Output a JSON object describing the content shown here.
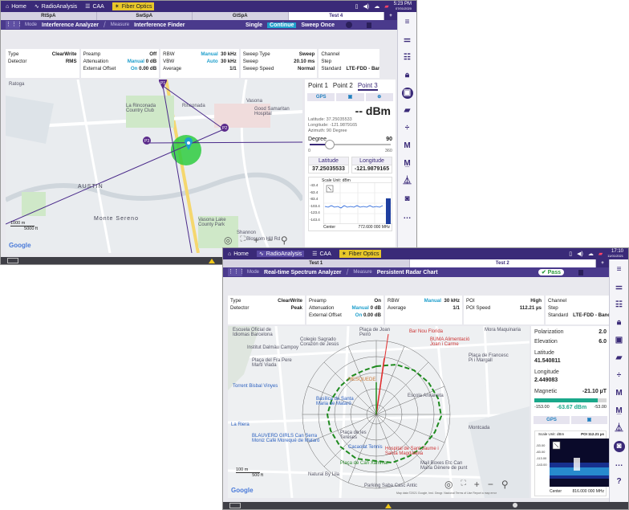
{
  "app": {
    "home": "Home",
    "radio_analysis": "RadioAnalysis",
    "caa": "CAA",
    "fiber_optics": "Fiber Optics"
  },
  "win1": {
    "time": "5:23 PM",
    "date": "07/01/2020",
    "tabs": [
      "RtSpA",
      "SwSpA",
      "GtSpA",
      "Test 4"
    ],
    "mode_label": "Mode",
    "mode_value": "Interference Analyzer",
    "measure_label": "Measure",
    "measure_value": "Interference Finder",
    "single": "Single",
    "continue": "Continue",
    "sweep_once": "Sweep Once",
    "params": {
      "type_label": "Type",
      "type_value": "ClearWrite",
      "detector_label": "Detector",
      "detector_value": "RMS",
      "preamp_label": "Preamp",
      "preamp_value": "Off",
      "atten_label": "Attenuation",
      "atten_mode": "Manual",
      "atten_value": "0 dB",
      "extoff_label": "External Offset",
      "extoff_mode": "On",
      "extoff_value": "0.00 dB",
      "rbw_label": "RBW",
      "rbw_mode": "Manual",
      "rbw_value": "30 kHz",
      "vbw_label": "VBW",
      "vbw_mode": "Auto",
      "vbw_value": "30 kHz",
      "avg_label": "Average",
      "avg_value": "1/1",
      "sweeptype_label": "Sweep Type",
      "sweeptype_value": "Sweep",
      "sweep_label": "Sweep",
      "sweep_value": "20.10 ms",
      "sweepspeed_label": "Sweep Speed",
      "sweepspeed_value": "Normal",
      "channel_label": "Channel",
      "step_label": "Step",
      "standard_label": "Standard",
      "standard_value": "LTE-FDD - Band"
    },
    "map_labels": [
      "Ratoga",
      "La Rinconada Country Club",
      "Rinconada",
      "Vasona",
      "Good Samaritan Hospital",
      "AUSTIN",
      "Monte Sereno",
      "Vasona Lake County Park",
      "Shannon",
      "Blossom Hill Rd"
    ],
    "scale_1": "1000 m",
    "scale_2": "5000 ft",
    "google": "Google",
    "markers": [
      "P1",
      "P2",
      "P3"
    ],
    "panel": {
      "tabs": [
        "Point 1",
        "Point 2",
        "Point 3"
      ],
      "gps": "GPS",
      "dbm": "-- dBm",
      "latitude_line": "Latitude: 37.25035533",
      "longitude_line": "Longitude: -121.9879165",
      "azimuth_line": "Azimuth: 90 Degree",
      "degree_label": "Degree",
      "degree_value": "90",
      "deg_min": "0",
      "deg_max": "360",
      "lat_h": "Latitude",
      "lat_v": "37.25035533",
      "lon_h": "Longitude",
      "lon_v": "-121.9879165",
      "scale_unit": "Scale Unit: dBm",
      "yticks": [
        "-43.4",
        "-63.4",
        "-83.4",
        "-103.4",
        "-123.4",
        "-143.4"
      ],
      "center_label": "Center",
      "center_value": "772.600 000 MHz"
    }
  },
  "win2": {
    "time": "17:10",
    "date": "11/01/2021",
    "tabs": [
      "Test 1",
      "Test 2"
    ],
    "mode_label": "Mode",
    "mode_value": "Real-time Spectrum Analyzer",
    "measure_label": "Measure",
    "measure_value": "Persistent Radar Chart",
    "pass": "Pass",
    "params": {
      "type_label": "Type",
      "type_value": "ClearWrite",
      "detector_label": "Detector",
      "detector_value": "Peak",
      "preamp_label": "Preamp",
      "preamp_value": "On",
      "atten_label": "Attenuation",
      "atten_mode": "Manual",
      "atten_value": "0 dB",
      "extoff_label": "External Offset",
      "extoff_mode": "On",
      "extoff_value": "0.00 dB",
      "rbw_label": "RBW",
      "rbw_mode": "Manual",
      "rbw_value": "30 kHz",
      "avg_label": "Average",
      "avg_value": "1/1",
      "poi_label": "POI",
      "poi_value": "High",
      "poispeed_label": "POI Speed",
      "poispeed_value": "112.21 µs",
      "channel_label": "Channel",
      "step_label": "Step",
      "standard_label": "Standard",
      "standard_value": "LTE-FDD - Band"
    },
    "map_labels": [
      "Escuela Oficial de Idiomas Barcelona",
      "Institut Dalmàu Campoy",
      "Colegio Sagrado Corazón de Jesús",
      "Plaça de Joan Peiró",
      "Bar Nou Florida",
      "BUMA Alimentació Joan i Carme",
      "Plaça del Fra Pere Martí Viada",
      "MESQUEDE",
      "Plaça de Francesc Pi i Margall",
      "Torrent Bisbal Vinyes",
      "Basílica de Santa Maria de Mataró",
      "Escola Anxaneta",
      "La Riera",
      "BLAUVERD GIRLS Can Serra Moniz Café Morequé de Mataró",
      "Plaça de les Tereses",
      "Cacaolat Tennis",
      "Hospital de Sant Jaume i Santa Magdalena",
      "Plaça de Can Xammar",
      "Mail Boxes Etc Can Maria Gènere de punt",
      "Parking Saba Casc Antic",
      "Natural By Lila",
      "Mora Maquinaria",
      "Montcada"
    ],
    "scale_1": "100 m",
    "scale_2": "500 ft",
    "google": "Google",
    "map_footer": "Map data ©2021 Google, Inst. Geogr. Nacional   Terms of Use   Report a map error",
    "panel": {
      "polarization_label": "Polarization",
      "polarization_value": "2.0",
      "elevation_label": "Elevation",
      "elevation_value": "6.0",
      "latitude_label": "Latitude",
      "latitude_value": "41.540811",
      "longitude_label": "Longitude",
      "longitude_value": "2.449083",
      "magnetic_label": "Magnetic",
      "magnetic_value": "-21.10 µT",
      "level_min": "-153.00",
      "level_value": "-63.67 dBm",
      "level_max": "-53.00",
      "level_fraction": 0.88,
      "gps": "GPS",
      "scale_unit": "Scale Unit: dBm",
      "poi_text": "POI 112.21 µs",
      "yticks": [
        "-53.00",
        "-83.00",
        "-113.00",
        "-143.00"
      ],
      "center_label": "Center",
      "center_value": "816.000 000 MHz"
    }
  },
  "colors": {
    "header": "#3a2a78",
    "accent": "#1f9fcc",
    "marker": "#5a2a8a",
    "circle": "#2ecc40",
    "radar_green": "#1e8a1e",
    "pass_green": "#2a9a3a",
    "warn": "#f0c81a"
  }
}
